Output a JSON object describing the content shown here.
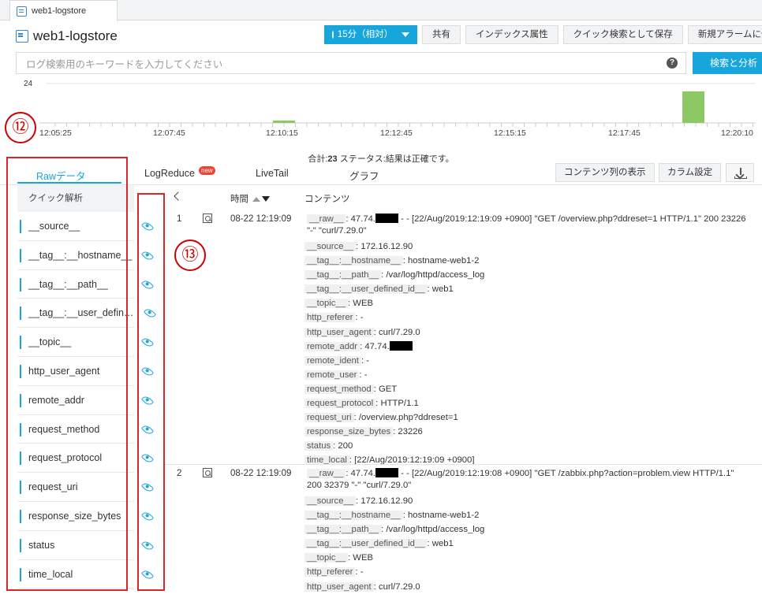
{
  "tab": {
    "label": "web1-logstore"
  },
  "title": "web1-logstore",
  "toolbar": {
    "time_range": "15分（相対）",
    "share": "共有",
    "index_attr": "インデックス属性",
    "save_quick": "クイック検索として保存",
    "new_alarm": "新規アラームに保存"
  },
  "search": {
    "placeholder": "ログ検索用のキーワードを入力してください",
    "help": "?",
    "button": "検索と分析"
  },
  "histogram": {
    "y_max": "24",
    "x_ticks": [
      "12:05:25",
      "12:07:45",
      "12:10:15",
      "12:12:45",
      "12:15:15",
      "12:17:45",
      "12:20:10"
    ],
    "bar_color": "#8cc864",
    "bars": [
      {
        "label": "12:10:15",
        "level": 0.08
      },
      {
        "label": "12:18:40",
        "level": 1.0
      }
    ]
  },
  "summary": {
    "prefix": "合計:",
    "total": "23",
    "status": " ステータス:結果は正確です。"
  },
  "view_tabs": {
    "raw": "Rawデータ",
    "logreduce": "LogReduce",
    "new_badge": "new",
    "livetail": "LiveTail",
    "graph": "グラフ"
  },
  "table_buttons": {
    "show_content_col": "コンテンツ列の表示",
    "col_settings": "カラム設定"
  },
  "quick_analysis": {
    "title": "クイック解析",
    "fields": [
      "__source__",
      "__tag__:__hostname__",
      "__tag__:__path__",
      "__tag__:__user_defin…",
      "__topic__",
      "http_user_agent",
      "remote_addr",
      "request_method",
      "request_protocol",
      "request_uri",
      "response_size_bytes",
      "status",
      "time_local"
    ]
  },
  "table_header": {
    "time": "時間",
    "content": "コンテンツ"
  },
  "annotations": {
    "left_number": "⑫",
    "right_number": "⑬",
    "color": "#d62828"
  },
  "logs": [
    {
      "index": "1",
      "time": "08-22 12:19:09",
      "raw_key": "__raw__",
      "raw_prefix": "47.74.",
      "raw_rest": " - - [22/Aug/2019:12:19:09 +0900] \"GET /overview.php?ddreset=1 HTTP/1.1\" 200 23226 \"-\" \"curl/7.29.0\"",
      "fields": [
        {
          "k": "__source__",
          "v": "172.16.12.90"
        },
        {
          "k": "__tag__:__hostname__",
          "v": "hostname-web1-2"
        },
        {
          "k": "__tag__:__path__",
          "v": "/var/log/httpd/access_log"
        },
        {
          "k": "__tag__:__user_defined_id__",
          "v": "web1"
        },
        {
          "k": "__topic__",
          "v": "WEB"
        },
        {
          "k": "http_referer",
          "v": "-"
        },
        {
          "k": "http_user_agent",
          "v": "curl/7.29.0"
        },
        {
          "k": "remote_addr",
          "v": "47.74."
        },
        {
          "k": "remote_ident",
          "v": "-"
        },
        {
          "k": "remote_user",
          "v": "-"
        },
        {
          "k": "request_method",
          "v": "GET"
        },
        {
          "k": "request_protocol",
          "v": "HTTP/1.1"
        },
        {
          "k": "request_uri",
          "v": "/overview.php?ddreset=1"
        },
        {
          "k": "response_size_bytes",
          "v": "23226"
        },
        {
          "k": "status",
          "v": "200"
        },
        {
          "k": "time_local",
          "v": "[22/Aug/2019:12:19:09 +0900]"
        }
      ]
    },
    {
      "index": "2",
      "time": "08-22 12:19:09",
      "raw_key": "__raw__",
      "raw_prefix": "47.74.",
      "raw_rest": " - - [22/Aug/2019:12:19:08 +0900] \"GET /zabbix.php?action=problem.view HTTP/1.1\" 200 32379 \"-\" \"curl/7.29.0\"",
      "fields": [
        {
          "k": "__source__",
          "v": "172.16.12.90"
        },
        {
          "k": "__tag__:__hostname__",
          "v": "hostname-web1-2"
        },
        {
          "k": "__tag__:__path__",
          "v": "/var/log/httpd/access_log"
        },
        {
          "k": "__tag__:__user_defined_id__",
          "v": "web1"
        },
        {
          "k": "__topic__",
          "v": "WEB"
        },
        {
          "k": "http_referer",
          "v": "-"
        },
        {
          "k": "http_user_agent",
          "v": "curl/7.29.0"
        }
      ]
    }
  ]
}
